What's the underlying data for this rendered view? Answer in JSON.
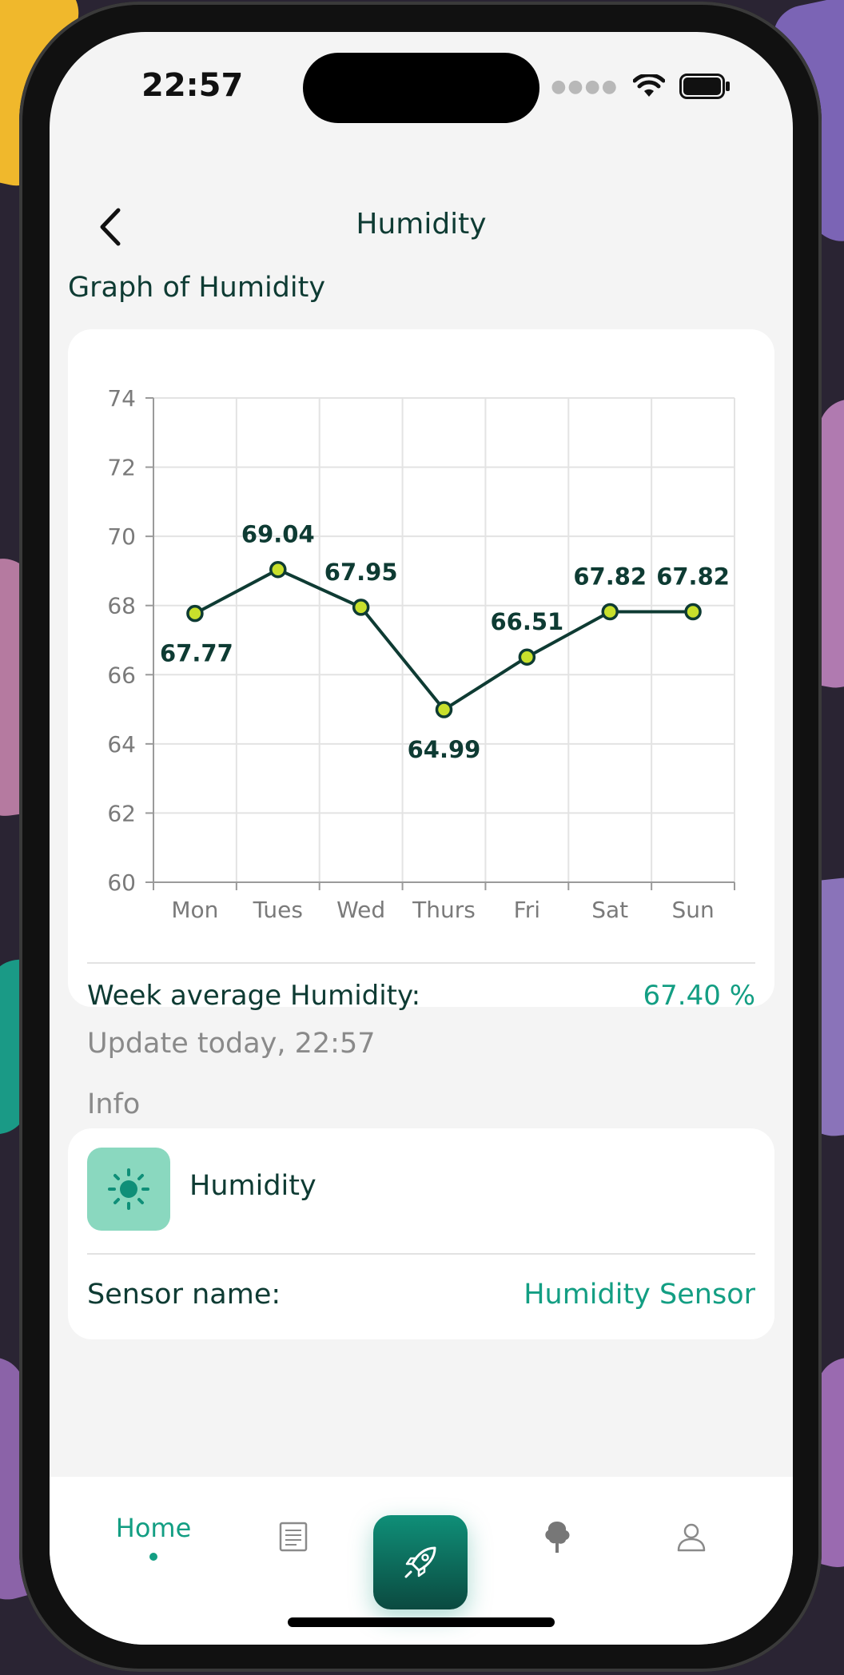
{
  "status": {
    "time": "22:57"
  },
  "header": {
    "title": "Humidity"
  },
  "chart_section": {
    "title": "Graph of Humidity"
  },
  "chart_data": {
    "type": "line",
    "categories": [
      "Mon",
      "Tues",
      "Wed",
      "Thurs",
      "Fri",
      "Sat",
      "Sun"
    ],
    "values": [
      67.77,
      69.04,
      67.95,
      64.99,
      66.51,
      67.82,
      67.82
    ],
    "value_labels": [
      "67.77",
      "69.04",
      "67.95",
      "64.99",
      "66.51",
      "67.82",
      "67.82"
    ],
    "yticks": [
      "60",
      "62",
      "64",
      "66",
      "68",
      "70",
      "72",
      "74"
    ],
    "ylim": [
      60,
      74
    ],
    "grid": true,
    "line_color": "#0e3b33",
    "marker_color": "#c8e02c"
  },
  "summary": {
    "label": "Week average Humidity:",
    "value": "67.40 %"
  },
  "update": {
    "text": "Update today, 22:57"
  },
  "info": {
    "title": "Info",
    "name": "Humidity",
    "sensor_label": "Sensor name:",
    "sensor_value": "Humidity Sensor"
  },
  "tabbar": {
    "home_label": "Home"
  },
  "colors": {
    "accent": "#139e83",
    "dark": "#0e3b33",
    "icon_bg": "#8ad8bf"
  }
}
